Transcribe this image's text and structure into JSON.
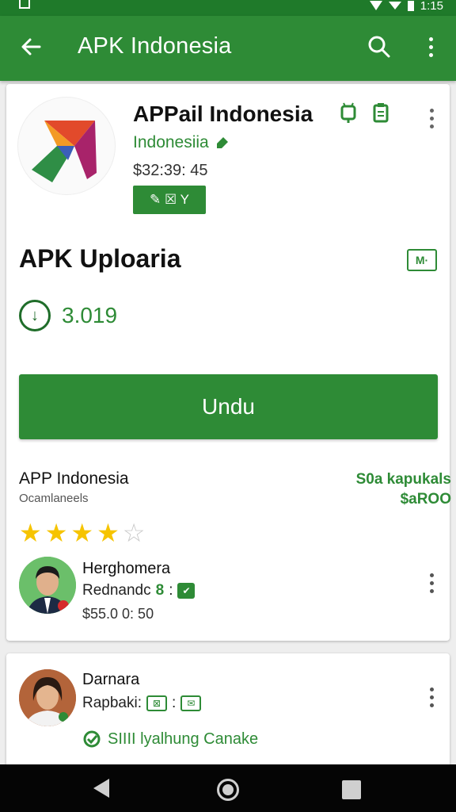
{
  "status_bar": {
    "time": "1:15"
  },
  "app_bar": {
    "title": "APK Indonesia",
    "icons": {
      "back": "arrow-back-icon",
      "search": "search-icon",
      "more": "more-vert-icon"
    }
  },
  "app_header": {
    "name": "APPail Indonesia",
    "developer": "Indonesiia",
    "price": "$32:39: 45",
    "badge_text": "✎ ☒ Y"
  },
  "section": {
    "title": "APK Uploaria",
    "icon_text": "M·",
    "size": "3.019"
  },
  "download_button": {
    "label": "Undu"
  },
  "review_summary": {
    "app_name": "APP Indonesia",
    "subtitle": "Ocamlaneels",
    "right_line1": "S0a kapukals",
    "right_line2": "$aROO",
    "rating": 4,
    "max_rating": 5
  },
  "reviews": [
    {
      "name": "Herghomera",
      "meta": "Rednandc",
      "price": "$55.0 0: 50"
    },
    {
      "name": "Darnara",
      "meta": "Rapbaki:",
      "link": "SIIII lyalhung Canake"
    }
  ],
  "colors": {
    "brand_green": "#2e8b36",
    "dark_green": "#1f7a2a",
    "star": "#f6c400"
  }
}
